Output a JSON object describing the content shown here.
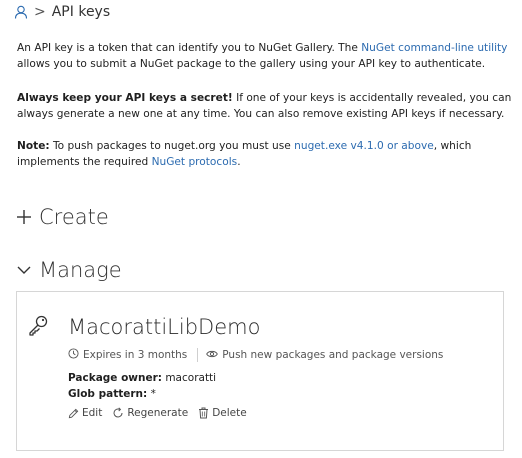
{
  "breadcrumb": {
    "separator": ">",
    "page": "API keys"
  },
  "intro": {
    "p1_before": "An API key is a token that can identify you to NuGet Gallery. The ",
    "p1_link": "NuGet command-line utility",
    "p1_after": " allows you to submit a NuGet package to the gallery using your API key to authenticate.",
    "p2_bold": "Always keep your API keys a secret!",
    "p2_rest": " If one of your keys is accidentally revealed, you can always generate a new one at any time. You can also remove existing API keys if necessary.",
    "p3_bold": "Note:",
    "p3_before": " To push packages to nuget.org you must use ",
    "p3_link1": "nuget.exe v4.1.0 or above",
    "p3_middle": ", which implements the required ",
    "p3_link2": "NuGet protocols",
    "p3_after": "."
  },
  "sections": {
    "create_label": "Create",
    "manage_label": "Manage"
  },
  "key": {
    "name": "MacorattiLibDemo",
    "expires": "Expires in 3 months",
    "scope": "Push new packages and package versions",
    "owner_label": "Package owner:",
    "owner_value": "macoratti",
    "glob_label": "Glob pattern:",
    "glob_value": "*",
    "actions": {
      "edit": "Edit",
      "regenerate": "Regenerate",
      "delete": "Delete"
    }
  },
  "icons": {
    "breadcrumb": "user-icon",
    "create": "plus-icon",
    "manage": "chevron-down-icon",
    "key": "key-icon",
    "expires": "clock-icon",
    "scope": "eye-icon",
    "edit": "pencil-icon",
    "regenerate": "refresh-icon",
    "delete": "trash-icon"
  },
  "colors": {
    "link": "#2c6bb0",
    "text": "#1f1f1f",
    "card_border": "#d6d6d6"
  }
}
